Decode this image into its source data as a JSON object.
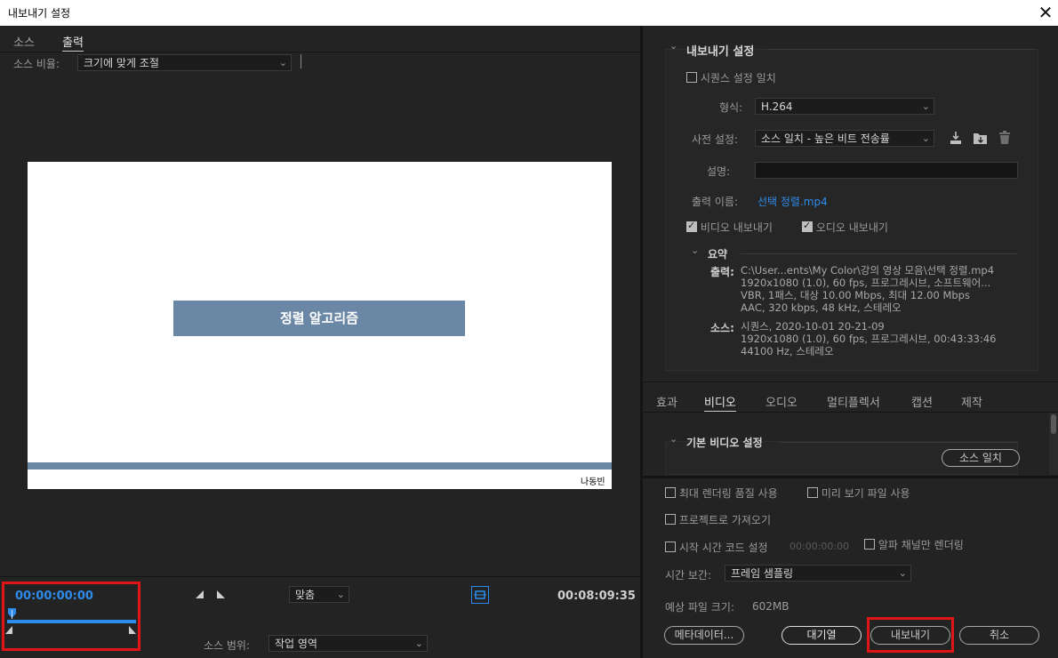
{
  "window": {
    "title": "내보내기 설정",
    "close_glyph": "✕"
  },
  "left": {
    "tabs": [
      "소스",
      "출력"
    ],
    "source_scale_label": "소스 비율:",
    "source_scale_value": "크기에 맞게 조절",
    "preview": {
      "slide_title": "정렬 알고리즘",
      "author": "나동빈"
    },
    "timecode_start": "00:00:00:00",
    "timecode_end": "00:08:09:35",
    "fit_value": "맞춤",
    "source_range_label": "소스 범위:",
    "source_range_value": "작업 영역",
    "playhead_progress": 0.0
  },
  "export_settings": {
    "header": "내보내기 설정",
    "match_sequence_label": "시퀀스 설정 일치",
    "format_label": "형식:",
    "format_value": "H.264",
    "preset_label": "사전 설정:",
    "preset_value": "소스 일치 - 높은 비트 전송률",
    "comment_label": "설명:",
    "output_name_label": "출력 이름:",
    "output_name_value": "선택 정렬.mp4",
    "export_video_label": "비디오 내보내기",
    "export_audio_label": "오디오 내보내기",
    "summary_label": "요약",
    "summary_output_key": "출력:",
    "summary_output_lines": [
      "C:\\User...ents\\My  Color\\강의 영상 모음\\선택 정렬.mp4",
      "1920x1080 (1.0), 60 fps, 프로그레시브, 소프트웨어...",
      "VBR, 1패스, 대상 10.00 Mbps, 최대 12.00 Mbps",
      "AAC, 320 kbps, 48 kHz, 스테레오"
    ],
    "summary_source_key": "소스:",
    "summary_source_lines": [
      "시퀀스, 2020-10-01 20-21-09",
      "1920x1080 (1.0), 60 fps, 프로그레시브, 00:43:33:46",
      "44100 Hz, 스테레오"
    ]
  },
  "settings_tabs": [
    "효과",
    "비디오",
    "오디오",
    "멀티플렉서",
    "캡션",
    "제작"
  ],
  "basic_video": {
    "header": "기본 비디오 설정",
    "match_source_button": "소스 일치"
  },
  "bottom": {
    "max_render_quality": "최대 렌더링 품질 사용",
    "use_previews": "미리 보기 파일 사용",
    "import_into_project": "프로젝트로 가져오기",
    "set_start_timecode": "시작 시간 코드 설정",
    "start_timecode_value": "00:00:00:00",
    "render_alpha_only": "알파 채널만 렌더링",
    "time_interpolation_label": "시간 보간:",
    "time_interpolation_value": "프레임 샘플링",
    "estimated_size_label": "예상 파일 크기:",
    "estimated_size_value": "602MB",
    "metadata_button": "메타데이터...",
    "queue_button": "대기열",
    "export_button": "내보내기",
    "cancel_button": "취소"
  }
}
